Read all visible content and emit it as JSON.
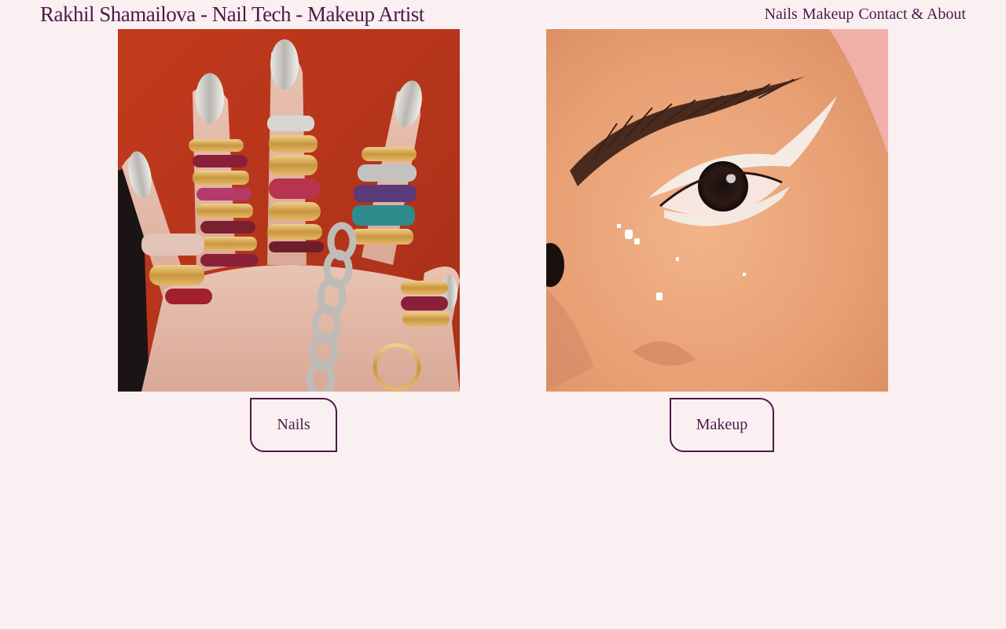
{
  "header": {
    "title": "Rakhil Shamailova - Nail Tech - Makeup Artist",
    "nav": [
      {
        "label": "Nails"
      },
      {
        "label": "Makeup"
      },
      {
        "label": "Contact & About"
      }
    ]
  },
  "cards": [
    {
      "image": "nails-photo",
      "button_label": "Nails"
    },
    {
      "image": "makeup-photo",
      "button_label": "Makeup"
    }
  ],
  "colors": {
    "background": "#fbf0f1",
    "accent": "#4a1a4a"
  }
}
